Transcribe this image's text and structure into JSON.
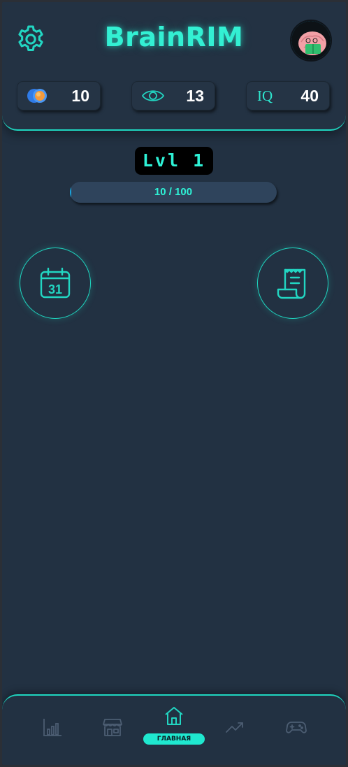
{
  "header": {
    "title": "BrainRIM",
    "stats": {
      "coins": "10",
      "views": "13",
      "iq_label": "IQ",
      "iq": "40"
    }
  },
  "level": {
    "label": "Lvl 1",
    "progress_text": "10 / 100",
    "progress_fraction": 0.1
  },
  "actions": {
    "calendar_day": "31"
  },
  "nav": {
    "active_label": "ГЛАВНАЯ",
    "items": [
      "stats",
      "shop",
      "home",
      "trending",
      "games"
    ]
  },
  "colors": {
    "accent": "#1fd6c0",
    "background": "#223142",
    "inactive_icon": "#4c5d72"
  }
}
